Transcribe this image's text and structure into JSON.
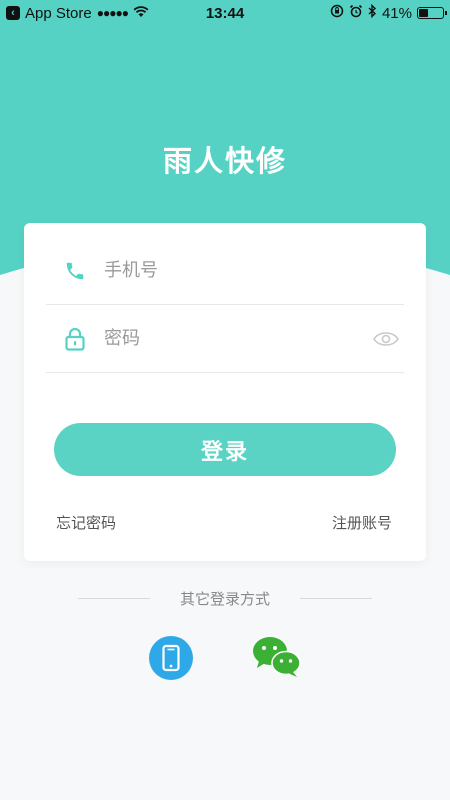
{
  "status_bar": {
    "back_app": "App Store",
    "signal": "●●●●●",
    "time": "13:44",
    "battery_percent": "41%",
    "battery_level": 0.41
  },
  "app_title": "雨人快修",
  "login_form": {
    "phone_placeholder": "手机号",
    "password_placeholder": "密码",
    "login_button": "登录",
    "forgot_password": "忘记密码",
    "register_account": "注册账号"
  },
  "other_login": {
    "label": "其它登录方式"
  },
  "icons": {
    "phone": "phone-icon",
    "lock": "lock-icon",
    "eye": "eye-icon",
    "mobile_login": "mobile-icon",
    "wechat_login": "wechat-icon"
  },
  "colors": {
    "accent": "#5ad3c4",
    "mobile_blue": "#2fa8e8",
    "wechat_green": "#3cb034"
  }
}
